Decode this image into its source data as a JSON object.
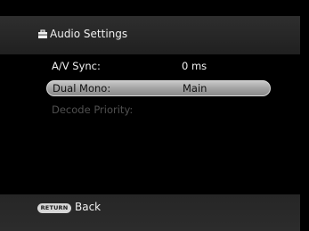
{
  "header": {
    "title": "Audio Settings",
    "icon": "toolbox-icon"
  },
  "settings": {
    "rows": [
      {
        "label": "A/V Sync:",
        "value": "0 ms",
        "state": "normal"
      },
      {
        "label": "Dual Mono:",
        "value": "Main",
        "state": "selected"
      },
      {
        "label": "Decode Priority:",
        "value": "",
        "state": "disabled"
      }
    ]
  },
  "footer": {
    "return_key": "RETURN",
    "back_label": "Back"
  },
  "colors": {
    "background": "#000000",
    "bar": "#2a2a2a",
    "highlight": "#b0b0b0",
    "disabled_text": "#505050"
  }
}
